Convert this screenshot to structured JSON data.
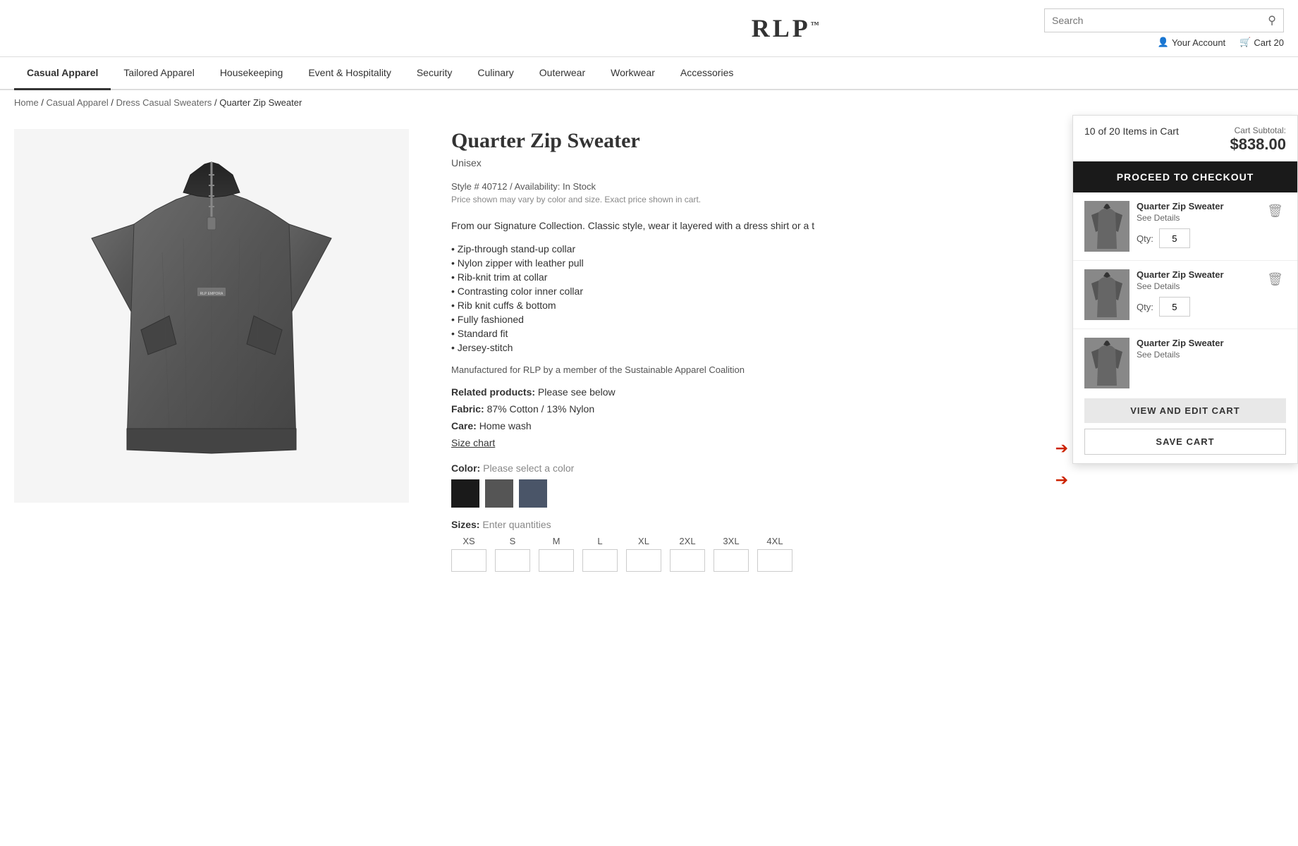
{
  "header": {
    "logo": "RLP",
    "logo_tm": "™",
    "search_placeholder": "Search",
    "account_label": "Your Account",
    "cart_label": "Cart 20"
  },
  "nav": {
    "items": [
      {
        "label": "Casual Apparel",
        "active": true
      },
      {
        "label": "Tailored Apparel",
        "active": false
      },
      {
        "label": "Housekeeping",
        "active": false
      },
      {
        "label": "Event & Hospitality",
        "active": false
      },
      {
        "label": "Security",
        "active": false
      },
      {
        "label": "Culinary",
        "active": false
      },
      {
        "label": "Outerwear",
        "active": false
      },
      {
        "label": "Workwear",
        "active": false
      },
      {
        "label": "Accessories",
        "active": false
      }
    ]
  },
  "breadcrumb": {
    "home": "Home",
    "casual_apparel": "Casual Apparel",
    "dress_casual_sweaters": "Dress Casual Sweaters",
    "current": "Quarter Zip Sweater"
  },
  "product": {
    "title": "Quarter Zip Sweater",
    "subtitle": "Unisex",
    "style": "Style # 40712 / Availability: In Stock",
    "price_note": "Price shown may vary by color and size. Exact price shown in cart.",
    "description": "From our Signature Collection. Classic style, wear it layered with a dress shirt or a t",
    "features": [
      "• Zip-through stand-up collar",
      "• Nylon zipper with leather pull",
      "• Rib-knit trim at collar",
      "• Contrasting color inner collar",
      "• Rib knit cuffs & bottom",
      "• Fully fashioned",
      "• Standard fit",
      "• Jersey-stitch"
    ],
    "manufactured": "Manufactured for RLP by a member of the Sustainable Apparel Coalition",
    "related_label": "Related products:",
    "related_value": "Please see below",
    "fabric_label": "Fabric:",
    "fabric_value": "87% Cotton / 13% Nylon",
    "care_label": "Care:",
    "care_value": "Home wash",
    "size_chart": "Size chart",
    "color_label": "Color:",
    "color_placeholder": "Please select a color",
    "colors": [
      {
        "name": "black",
        "hex": "#1a1a1a"
      },
      {
        "name": "charcoal",
        "hex": "#555555"
      },
      {
        "name": "navy",
        "hex": "#4a5568"
      }
    ],
    "sizes_label": "Sizes:",
    "sizes_placeholder": "Enter quantities",
    "sizes": [
      "XS",
      "S",
      "M",
      "L",
      "XL",
      "2XL",
      "3XL",
      "4XL"
    ]
  },
  "cart": {
    "items_count": "10 of 20 Items in Cart",
    "subtotal_label": "Cart Subtotal:",
    "subtotal_amount": "$838.00",
    "checkout_label": "PROCEED TO CHECKOUT",
    "items": [
      {
        "title": "Quarter Zip Sweater",
        "link": "See Details",
        "qty": 5
      },
      {
        "title": "Quarter Zip Sweater",
        "link": "See Details",
        "qty": 5
      },
      {
        "title": "Quarter Zip Sweater",
        "link": "See Details",
        "qty": null
      }
    ],
    "view_edit_label": "VIEW AND EDIT CART",
    "save_cart_label": "SAVE CART"
  }
}
